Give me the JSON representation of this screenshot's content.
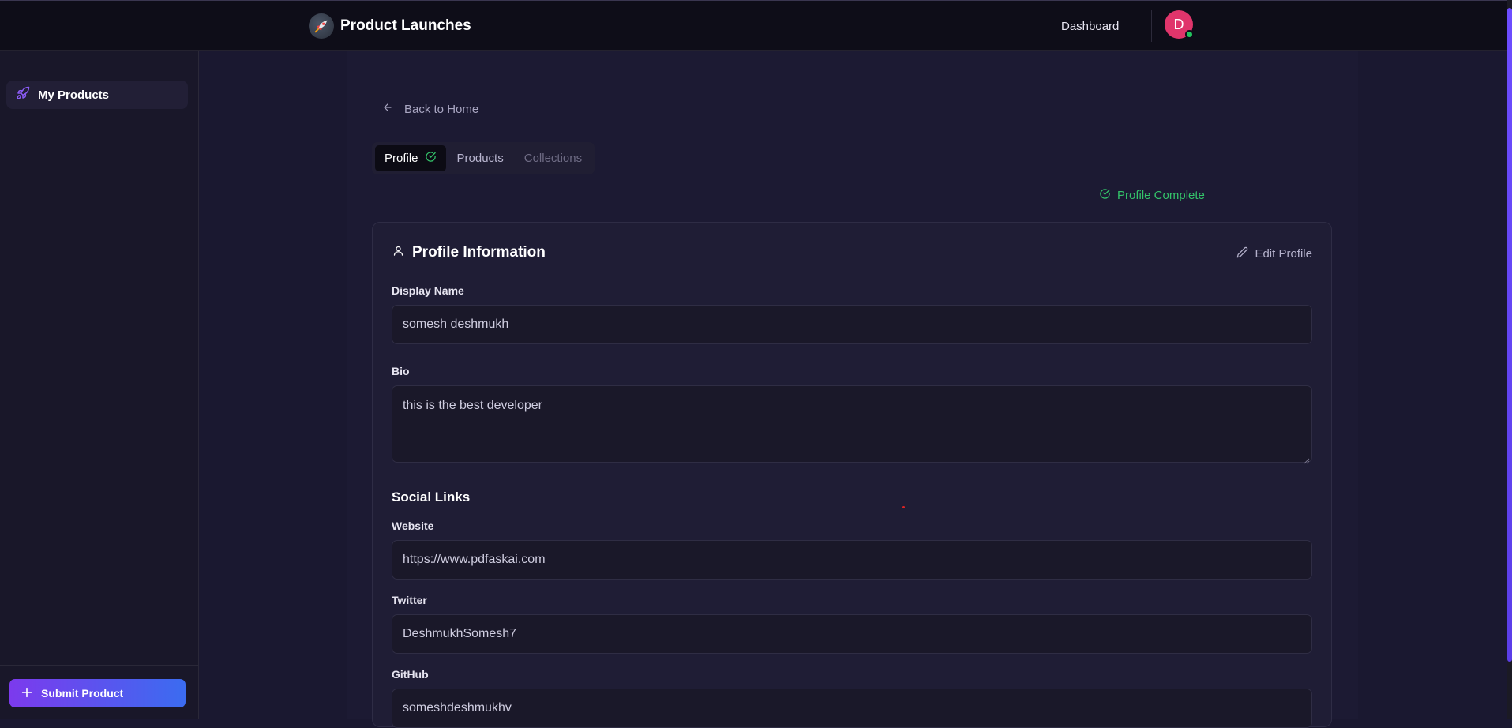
{
  "header": {
    "brand_title": "Product Launches",
    "nav_dashboard": "Dashboard",
    "avatar_initial": "D"
  },
  "sidebar": {
    "items": [
      {
        "label": "My Products",
        "icon": "rocket-icon"
      }
    ],
    "submit_label": "Submit Product"
  },
  "main": {
    "back_label": "Back to Home",
    "tabs": [
      {
        "label": "Profile",
        "active": true,
        "icon": "check-circle-icon"
      },
      {
        "label": "Products",
        "active": false
      },
      {
        "label": "Collections",
        "active": false
      }
    ],
    "status_label": "Profile Complete",
    "card": {
      "title": "Profile Information",
      "edit_label": "Edit Profile",
      "display_name_label": "Display Name",
      "display_name_value": "somesh deshmukh",
      "bio_label": "Bio",
      "bio_value": "this is the best developer",
      "social_title": "Social Links",
      "website_label": "Website",
      "website_value": "https://www.pdfaskai.com",
      "twitter_label": "Twitter",
      "twitter_value": "DeshmukhSomesh7",
      "github_label": "GitHub",
      "github_value": "someshdeshmukhv"
    }
  },
  "colors": {
    "accent_green": "#34c46a",
    "avatar_bg": "#e0356b",
    "submit_gradient_start": "#7c3aed",
    "submit_gradient_end": "#3b6cf0"
  }
}
